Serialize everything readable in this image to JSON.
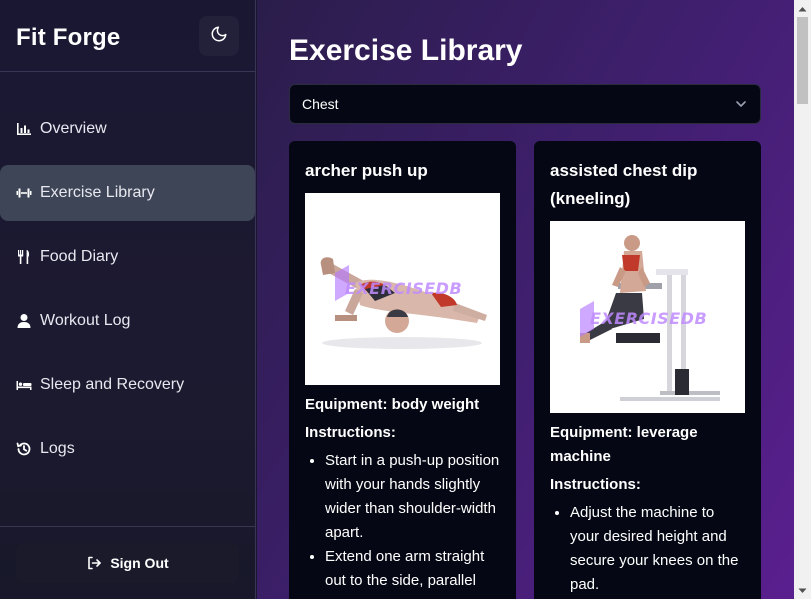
{
  "app": {
    "brand": "Fit Forge"
  },
  "sidebar": {
    "items": [
      {
        "label": "Overview",
        "icon": "bar-chart-icon"
      },
      {
        "label": "Exercise Library",
        "icon": "dumbbell-icon",
        "active": true
      },
      {
        "label": "Food Diary",
        "icon": "utensils-icon"
      },
      {
        "label": "Workout Log",
        "icon": "user-icon"
      },
      {
        "label": "Sleep and Recovery",
        "icon": "bed-icon"
      },
      {
        "label": "Logs",
        "icon": "history-icon"
      }
    ],
    "sign_out": "Sign Out"
  },
  "main": {
    "title": "Exercise Library",
    "filter": {
      "selected": "Chest"
    },
    "cards": [
      {
        "title": "archer push up",
        "watermark": "EXERCISEDB",
        "equipment": "Equipment: body weight",
        "instructions_label": "Instructions:",
        "instructions": [
          "Start in a push-up position with your hands slightly wider than shoulder-width apart.",
          "Extend one arm straight out to the side, parallel"
        ]
      },
      {
        "title": "assisted chest dip (kneeling)",
        "watermark": "EXERCISEDB",
        "equipment": "Equipment: leverage machine",
        "instructions_label": "Instructions:",
        "instructions": [
          "Adjust the machine to your desired height and secure your knees on the pad."
        ]
      }
    ]
  },
  "colors": {
    "sidebar_bg": "#1a1732",
    "active_item": "#3d4556",
    "main_gradient_start": "#2a1d4a",
    "main_gradient_end": "#5a1f8f",
    "card_bg": "#050814"
  }
}
